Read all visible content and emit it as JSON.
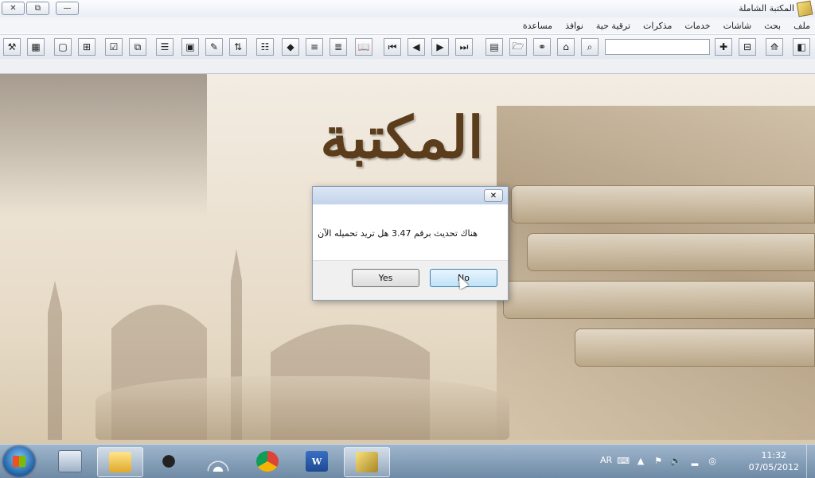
{
  "window": {
    "title": "المكتبة الشاملة",
    "controls": {
      "close": "✕",
      "restore": "⧉",
      "minimize": "—"
    }
  },
  "menu": [
    "ملف",
    "بحث",
    "شاشات",
    "خدمات",
    "مذكرات",
    "ترقية حية",
    "نوافذ",
    "مساعدة"
  ],
  "toolbar": {
    "search_value": "",
    "icons": [
      "tools-icon",
      "calculator-icon",
      "new-document-icon",
      "tree-icon",
      "clipboard-icon",
      "copy-icon",
      "document-list-icon",
      "image-icon",
      "pencil-icon",
      "transfer-icon",
      "properties-icon",
      "pdf-icon",
      "list-icon",
      "lines-icon",
      "book-icon",
      "first-icon",
      "previous-icon",
      "next-icon",
      "last-icon",
      "windows-icon",
      "open-folder-icon",
      "binoculars-icon",
      "home-icon",
      "zoom-icon",
      "new-folder-icon",
      "tree-view-icon",
      "open-book-icon",
      "library-icon"
    ]
  },
  "logo": {
    "text": "المكتبة الشاملة"
  },
  "dialog": {
    "message": "هناك تحديث برقم 3.47 هل تريد تحميله الآن",
    "yes_label": "Yes",
    "no_label": "No",
    "close": "✕"
  },
  "taskbar": {
    "apps": [
      "file-explorer-icon",
      "inkscape-icon",
      "network-icon",
      "chrome-icon",
      "word-icon",
      "shamela-icon"
    ],
    "language": "AR",
    "time": "11:32",
    "date": "07/05/2012"
  },
  "colors": {
    "accent": "#3c7fb1",
    "logo": "#5b3d1b",
    "taskbar": "#7f98b3"
  }
}
